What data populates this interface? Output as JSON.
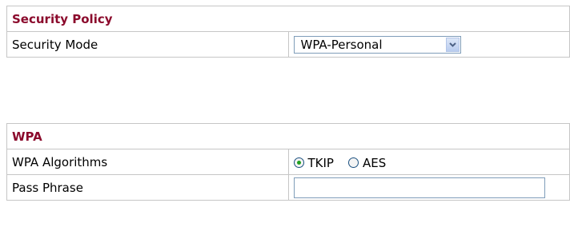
{
  "security_policy": {
    "header": "Security Policy",
    "mode_label": "Security Mode",
    "mode_value": "WPA-Personal"
  },
  "wpa": {
    "header": "WPA",
    "algorithms_label": "WPA Algorithms",
    "algorithms": [
      {
        "label": "TKIP",
        "selected": true
      },
      {
        "label": "AES",
        "selected": false
      }
    ],
    "pass_phrase_label": "Pass Phrase",
    "pass_phrase_value": ""
  },
  "colors": {
    "header_text": "#8b0a2c",
    "border": "#c6c6c6",
    "radio_checked": "#21a121"
  }
}
